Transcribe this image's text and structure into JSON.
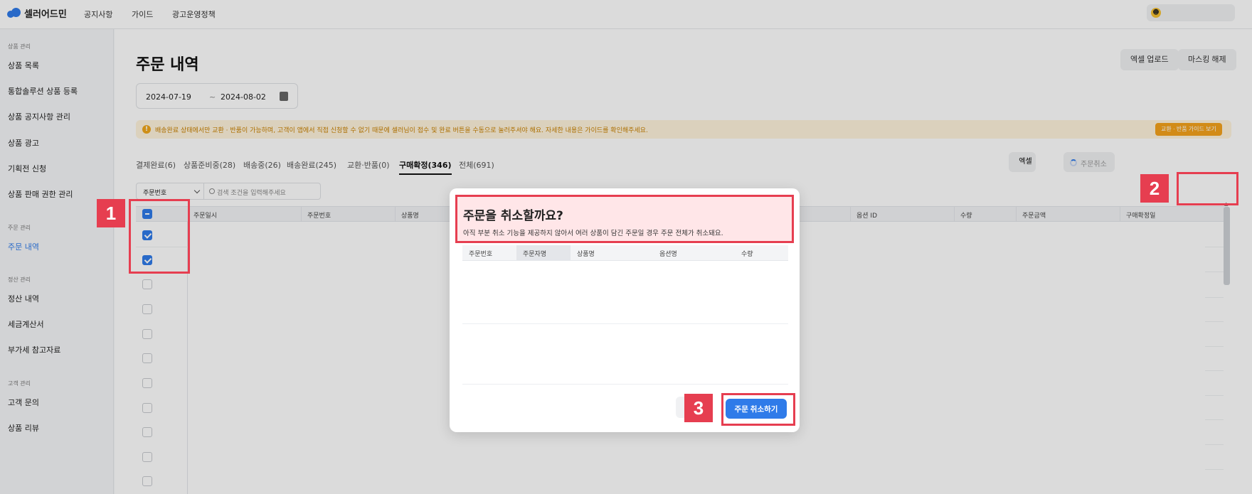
{
  "app": {
    "logo_text": "셀러어드민"
  },
  "topnav": {
    "items": [
      "공지사항",
      "가이드",
      "광고운영정책"
    ]
  },
  "sidebar": {
    "groups": [
      {
        "label": "상품 관리",
        "items": [
          "상품 목록",
          "통합솔루션 상품 등록",
          "상품 공지사항 관리",
          "상품 광고",
          "기획전 신청",
          "상품 판매 권한 관리"
        ]
      },
      {
        "label": "주문 관리",
        "items": [
          "주문 내역"
        ]
      },
      {
        "label": "정산 관리",
        "items": [
          "정산 내역",
          "세금계산서",
          "부가세 참고자료"
        ]
      },
      {
        "label": "고객 관리",
        "items": [
          "고객 문의",
          "상품 리뷰"
        ]
      }
    ],
    "active_item": "주문 내역"
  },
  "page": {
    "title": "주문 내역",
    "excel_upload": "엑셀 업로드",
    "masking_off": "마스킹 해제",
    "date_from": "2024-07-19",
    "date_sep": "~",
    "date_to": "2024-08-02"
  },
  "notice": {
    "icon": "!",
    "text": "배송완료 상태에서만 교환 · 반품이 가능하며, 고객이 앱에서 직접 신청할 수 없기 때문에 셀러님이 접수 및 완료 버튼을 수동으로 눌러주셔야 해요. 자세한 내용은 가이드를 확인해주세요.",
    "button": "교환 · 반품 가이드 보기"
  },
  "tabs": [
    "결제완료(6)",
    "상품준비중(28)",
    "배송중(26)",
    "배송완료(245)",
    "교환·반품(0)",
    "구매확정(346)",
    "전체(691)"
  ],
  "active_tab_index": 5,
  "filter": {
    "select_value": "주문번호",
    "search_placeholder": "검색 조건을 입력해주세요"
  },
  "actions": {
    "excel_button": "엑셀",
    "cancel_order": "주문취소"
  },
  "table": {
    "headers": [
      "주문일시",
      "주문번호",
      "상품명",
      "옵션 ID",
      "수량",
      "주문금액",
      "구매확정일"
    ],
    "checkbox_states": [
      "indeterminate",
      "checked",
      "checked",
      "unchecked",
      "unchecked",
      "unchecked",
      "unchecked",
      "unchecked",
      "unchecked",
      "unchecked",
      "unchecked",
      "unchecked"
    ]
  },
  "modal": {
    "title": "주문을 취소할까요?",
    "description": "아직 부분 취소 기능을 제공하지 않아서 여러 상품이 담긴 주문일 경우 주문 전체가 취소돼요.",
    "headers": [
      "주문번호",
      "주문자명",
      "상품명",
      "옵션명",
      "수량"
    ],
    "confirm_button": "주문 취소하기"
  },
  "annotations": [
    "1",
    "2",
    "3"
  ],
  "colors": {
    "accent": "#2f7be9",
    "annotation": "#e63e50",
    "notice_bg": "#fff4dd",
    "notice_text": "#c98100"
  }
}
